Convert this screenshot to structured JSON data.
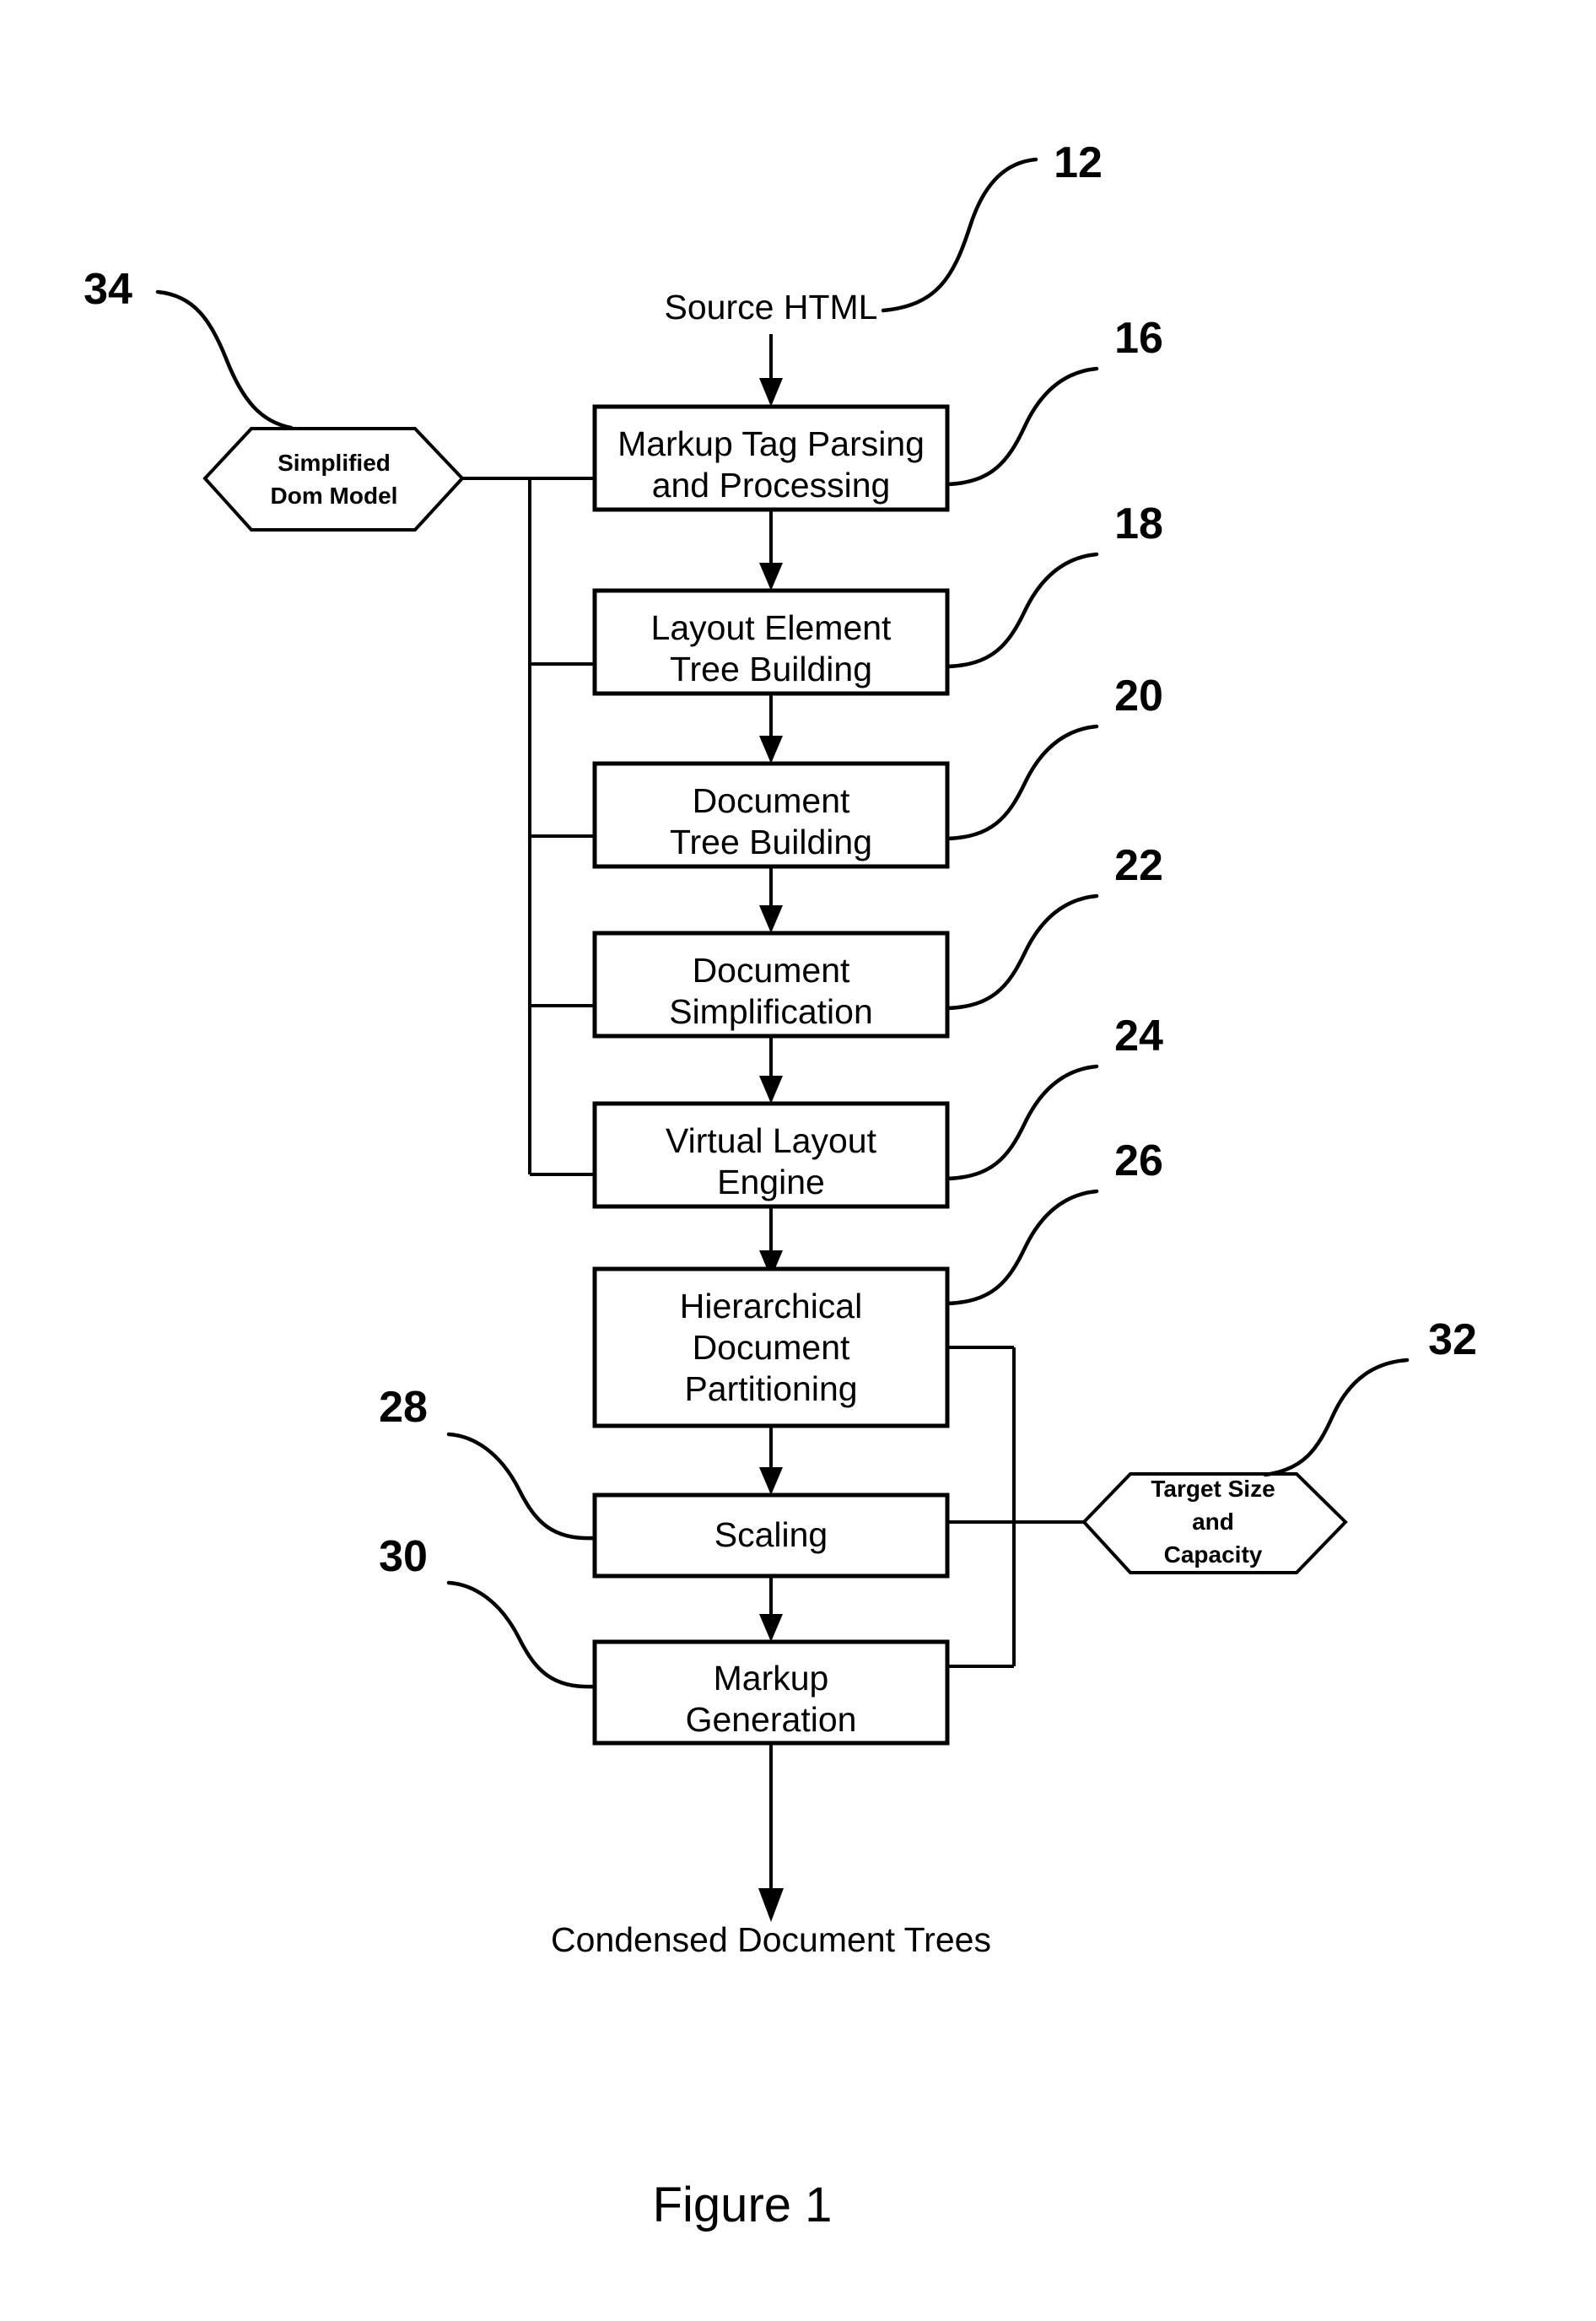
{
  "figure": {
    "caption": "Figure 1",
    "input_label": "Source HTML",
    "output_label": "Condensed  Document Trees"
  },
  "process_boxes": [
    {
      "id": "markup-tag-parsing",
      "line1": "Markup Tag Parsing",
      "line2": "and Processing",
      "line3": "",
      "ref": "16"
    },
    {
      "id": "layout-element-tree-building",
      "line1": "Layout Element",
      "line2": "Tree Building",
      "line3": "",
      "ref": "18"
    },
    {
      "id": "document-tree-building",
      "line1": "Document",
      "line2": "Tree Building",
      "line3": "",
      "ref": "20"
    },
    {
      "id": "document-simplification",
      "line1": "Document",
      "line2": "Simplification",
      "line3": "",
      "ref": "22"
    },
    {
      "id": "virtual-layout-engine",
      "line1": "Virtual Layout",
      "line2": "Engine",
      "line3": "",
      "ref": "24"
    },
    {
      "id": "hierarchical-document-partitioning",
      "line1": "Hierarchical",
      "line2": "Document",
      "line3": "Partitioning",
      "ref": "26"
    },
    {
      "id": "scaling",
      "line1": "Scaling",
      "line2": "",
      "line3": "",
      "ref": "28"
    },
    {
      "id": "markup-generation",
      "line1": "Markup",
      "line2": "Generation",
      "line3": "",
      "ref": "30"
    }
  ],
  "data_stores": [
    {
      "id": "simplified-dom-model",
      "line1": "Simplified",
      "line2": "Dom Model",
      "line3": "",
      "ref": "34"
    },
    {
      "id": "target-size-and-capacity",
      "line1": "Target Size",
      "line2": "and",
      "line3": "Capacity",
      "ref": "32"
    }
  ],
  "reference_numerals": {
    "source_html": "12",
    "markup_tag_parsing": "16",
    "layout_element_tree_building": "18",
    "document_tree_building": "20",
    "document_simplification": "22",
    "virtual_layout_engine": "24",
    "hierarchical_document_partitioning": "26",
    "scaling": "28",
    "markup_generation": "30",
    "target_size_and_capacity": "32",
    "simplified_dom_model": "34"
  },
  "colors": {
    "stroke": "#000000",
    "background": "#ffffff"
  }
}
